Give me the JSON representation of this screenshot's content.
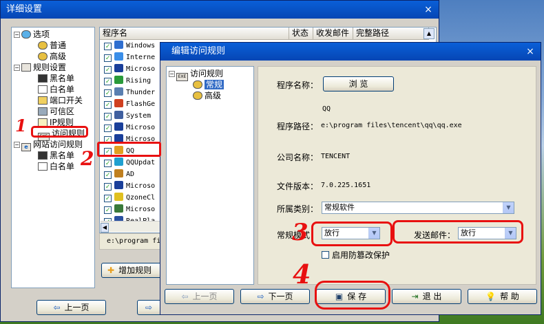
{
  "main_window": {
    "title": "详细设置",
    "close": "×",
    "tree": [
      {
        "label": "选项",
        "expander": "−"
      },
      {
        "label": "普通"
      },
      {
        "label": "高级"
      },
      {
        "label": "规则设置",
        "expander": "−"
      },
      {
        "label": "黑名单"
      },
      {
        "label": "白名单"
      },
      {
        "label": "端口开关"
      },
      {
        "label": "可信区"
      },
      {
        "label": "IP规则"
      },
      {
        "label": "访问规则",
        "icon_text": "EXE"
      },
      {
        "label": "网站访问规则",
        "expander": "−",
        "icon_text": "e"
      },
      {
        "label": "黑名单"
      },
      {
        "label": "白名单"
      }
    ],
    "list_columns": [
      "程序名",
      "状态",
      "收发邮件",
      "完整路径"
    ],
    "list_rows": [
      {
        "name": "Windows",
        "color": "#2f6fd0"
      },
      {
        "name": "Interne",
        "color": "#3a8ee8"
      },
      {
        "name": "Microso",
        "color": "#1a3f9a"
      },
      {
        "name": "Rising",
        "color": "#2a9a3a"
      },
      {
        "name": "Thunder",
        "color": "#5a7fb0"
      },
      {
        "name": "FlashGe",
        "color": "#d04020"
      },
      {
        "name": "System",
        "color": "#4060a0"
      },
      {
        "name": "Microso",
        "color": "#1a3f9a"
      },
      {
        "name": "Microso",
        "color": "#1a3f9a"
      },
      {
        "name": "QQ",
        "color": "#e0a020"
      },
      {
        "name": "QQUpdat",
        "color": "#20a0d0"
      },
      {
        "name": "AD",
        "color": "#c08020"
      },
      {
        "name": "Microso",
        "color": "#1a3f9a"
      },
      {
        "name": "QzoneCl",
        "color": "#e0c020"
      },
      {
        "name": "Microso",
        "color": "#3a7a3a"
      },
      {
        "name": "RealPla",
        "color": "#2a50a0"
      }
    ],
    "path_display": "e:\\program fi",
    "add_rule_button": "增加规则",
    "prev_page_button": "上一页"
  },
  "edit_dialog": {
    "title": "编辑访问规则",
    "close": "×",
    "tree": [
      {
        "label": "访问规则",
        "expander": "−",
        "icon_text": "EXE"
      },
      {
        "label": "常规"
      },
      {
        "label": "高级"
      }
    ],
    "program_name_label": "程序名称：",
    "browse_button": "浏 览",
    "program_name_value": "QQ",
    "program_path_label": "程序路径：",
    "program_path_value": "e:\\program files\\tencent\\qq\\qq.exe",
    "company_label": "公司名称：",
    "company_value": "TENCENT",
    "version_label": "文件版本：",
    "version_value": "7.0.225.1651",
    "category_label": "所属类别：",
    "category_value": "常规软件",
    "mode_label": "常规模式：",
    "mode_value": "放行",
    "mail_label": "发送邮件：",
    "mail_value": "放行",
    "tamper_label": "启用防篡改保护",
    "buttons": {
      "prev": "上一页",
      "next": "下一页",
      "save": "保 存",
      "exit": "退 出",
      "help": "帮 助"
    }
  },
  "annotations": [
    "1",
    "2",
    "3",
    "4"
  ],
  "colors": {
    "title_bar": "#0646b4",
    "annotation_red": "#e81010",
    "window_face": "#d4d0c8"
  }
}
